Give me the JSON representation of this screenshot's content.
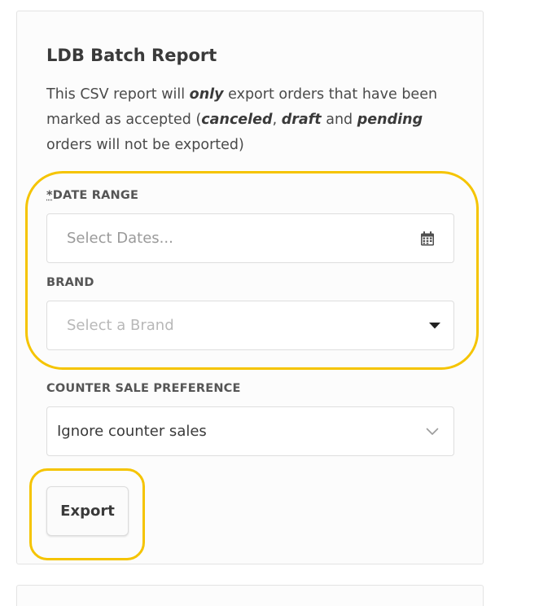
{
  "report": {
    "title": "LDB Batch Report",
    "description": {
      "p1": "This CSV report will ",
      "only": "only",
      "p2": " export orders that have been marked as accepted (",
      "canceled": "canceled",
      "comma": ", ",
      "draft": "draft",
      "and": " and ",
      "pending": "pending",
      "p3": " orders will not be exported)"
    }
  },
  "date_range": {
    "required_mark": "*",
    "label": "DATE RANGE",
    "placeholder": "Select Dates...",
    "icon": "calendar-icon"
  },
  "brand": {
    "label": "BRAND",
    "placeholder": "Select a Brand",
    "icon": "caret-down-icon"
  },
  "counter_sale": {
    "label": "COUNTER SALE PREFERENCE",
    "value": "Ignore counter sales",
    "icon": "chevron-down-icon"
  },
  "actions": {
    "export_label": "Export"
  },
  "colors": {
    "highlight": "#f5c400",
    "card_border": "#e3e3e3"
  }
}
